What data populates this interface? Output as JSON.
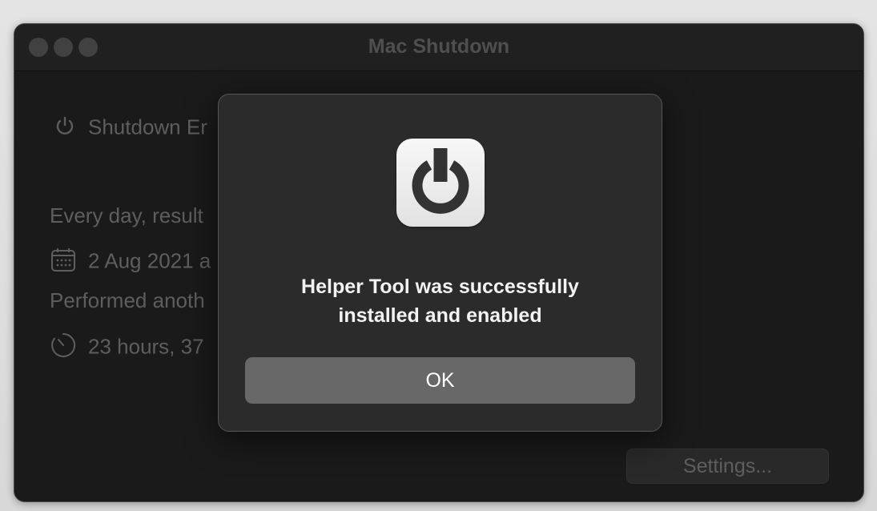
{
  "window": {
    "title": "Mac Shutdown"
  },
  "main": {
    "schedule_label": "Shutdown Er",
    "frequency_text": "Every day, result",
    "date_text": "2 Aug 2021 a",
    "performed_text": "Performed anoth",
    "countdown_text": "23 hours, 37",
    "settings_label": "Settings..."
  },
  "dialog": {
    "icon": "power-icon",
    "message_line1": "Helper Tool was successfully",
    "message_line2": "installed and enabled",
    "ok_label": "OK"
  },
  "colors": {
    "window_bg": "#1e1e1e",
    "dialog_bg": "#2b2b2b",
    "ok_button": "#686868",
    "icon_glyph": "#333333"
  }
}
